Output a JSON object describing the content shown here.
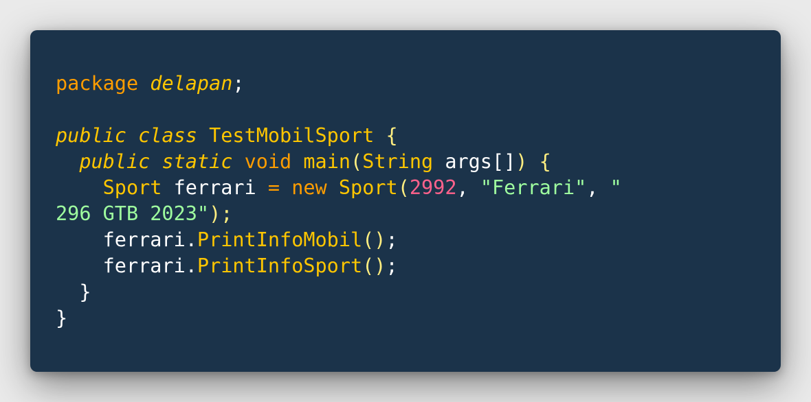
{
  "editor": {
    "language": "java",
    "theme_colors": {
      "background": "#1b334a",
      "keyword": "#ff9d00",
      "type": "#ffc600",
      "string": "#9fff9f",
      "number": "#ff628c",
      "plain": "#ffffff"
    },
    "tokens": {
      "l1_package": "package",
      "l1_name": "delapan",
      "l1_semi": ";",
      "l3_public": "public",
      "l3_class": "class",
      "l3_classname": "TestMobilSport",
      "l3_brace": "{",
      "l4_public": "public",
      "l4_static": "static",
      "l4_void": "void",
      "l4_main": "main",
      "l4_paren_open": "(",
      "l4_string": "String",
      "l4_args": "args[]",
      "l4_paren_close": ")",
      "l4_brace": "{",
      "l5_type": "Sport",
      "l5_var": "ferrari",
      "l5_eq": "=",
      "l5_new": "new",
      "l5_ctor": "Sport",
      "l5_paren_open": "(",
      "l5_num": "2992",
      "l5_comma1": ",",
      "l5_str1": "\"Ferrari\"",
      "l5_comma2": ",",
      "l5_str2_start": "\"",
      "l6_str2_end": "296 GTB 2023\"",
      "l6_close": ");",
      "l7_obj": "ferrari.",
      "l7_method": "PrintInfoMobil",
      "l7_parens": "()",
      "l7_semi": ";",
      "l8_obj": "ferrari.",
      "l8_method": "PrintInfoSport",
      "l8_parens": "()",
      "l8_semi": ";",
      "l9_brace": "}",
      "l10_brace": "}"
    }
  }
}
